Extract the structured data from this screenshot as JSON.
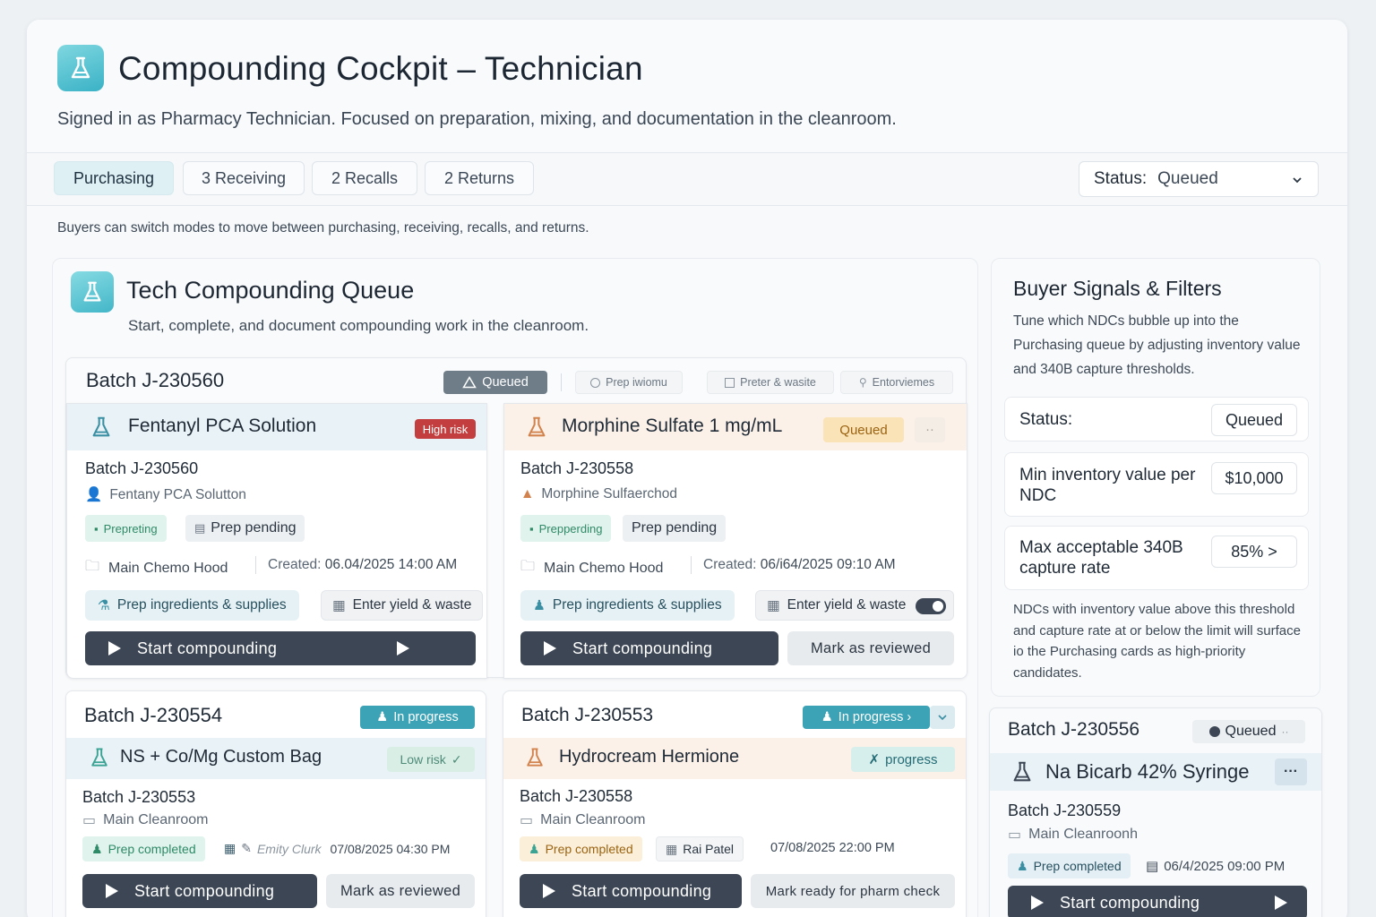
{
  "header": {
    "title": "Compounding Cockpit – Technician",
    "subtitle": "Signed in as Pharmacy Technician. Focused on preparation, mixing, and documentation in the cleanroom."
  },
  "tabs": [
    {
      "label": "Purchasing",
      "active": true
    },
    {
      "label": "3  Receiving",
      "active": false
    },
    {
      "label": "2  Recalls",
      "active": false
    },
    {
      "label": "2  Returns",
      "active": false
    }
  ],
  "status_filter": {
    "label": "Status:",
    "value": "Queued"
  },
  "helper_text": "Buyers can switch modes to move between purchasing, receiving, recalls, and returns.",
  "queue": {
    "title": "Tech Compounding Queue",
    "subtitle": "Start, complete, and document compounding work in the cleanroom.",
    "group": {
      "batch": "Batch J-230560",
      "status": "Queued",
      "chips": [
        "Prep iwiomu",
        "Preter & wasite",
        "Entorviemes"
      ],
      "cards": [
        {
          "product": "Fentanyl PCA Solution",
          "risk": "High risk",
          "batch": "Batch J-230560",
          "drug": "Fentany PCA Solutton",
          "stage_tag": "Prepreting",
          "prep_tag": "Prep pending",
          "location": "Main Chemo Hood",
          "created_label": "Created:",
          "created": "06.04/2025 14:00 AM",
          "action1": "Prep ingredients & supplies",
          "action2": "Enter yield & waste",
          "primary": "Start compounding"
        },
        {
          "product": "Morphine Sulfate 1 mg/mL",
          "status": "Queued",
          "more": "··",
          "batch": "Batch J-230558",
          "drug": "Morphine Sulfaerchod",
          "stage_tag": "Prepperding",
          "prep_tag": "Prep pending",
          "location": "Main Chemo Hood",
          "created_label": "Created:",
          "created": "06/i64/2025 09:10 AM",
          "action1": "Prep ingredients & supplies",
          "action2": "Enter yield & waste",
          "primary": "Start compounding",
          "secondary": "Mark as reviewed"
        }
      ]
    },
    "cards_bottom": [
      {
        "batch": "Batch J-230554",
        "status": "In progress",
        "product": "NS + Co/Mg Custom Bag",
        "risk": "Low risk",
        "sub_batch": "Batch J-230553",
        "location": "Main Cleanroom",
        "stage_tag": "Prep completed",
        "user": "Emity Clurk",
        "datetime": "07/08/2025  04:30 PM",
        "primary": "Start compounding",
        "secondary": "Mark as reviewed"
      },
      {
        "batch": "Batch J-230553",
        "status": "In progress ›",
        "product": "Hydrocream Hermione",
        "progress": "progress",
        "sub_batch": "Batch J-230558",
        "location": "Main Cleanroom",
        "stage_tag": "Prep completed",
        "user": "Rai Patel",
        "datetime": "07/08/2025 22:00 PM",
        "primary": "Start compounding",
        "secondary": "Mark ready for pharm check"
      }
    ]
  },
  "signals": {
    "title": "Buyer Signals & Filters",
    "description": "Tune which NDCs bubble up into  the Purchasing queue by adjusting inventory value and 340B capture thresholds.",
    "rows": [
      {
        "label": "Status:",
        "value": "Queued"
      },
      {
        "label": "Min inventory value per NDC",
        "value": "$10,000"
      },
      {
        "label": "Max acceptable 340B capture rate",
        "value": "85%   >"
      }
    ],
    "footnote": "NDCs with inventory value above this threshold and capture rate at or below the limit will surface io the Purchasing cards as high-priority candidates."
  },
  "side_card": {
    "batch": "Batch J-230556",
    "status": "Queued",
    "more": "··",
    "product": "Na Bicarb 42% Syringe",
    "menu": "···",
    "sub_batch": "Batch J-230559",
    "location": "Main Cleanroonh",
    "stage_tag": "Prep completed",
    "datetime": "06/4/2025 09:00 PM",
    "primary": "Start compounding"
  },
  "colors": {
    "accent": "#3ab2c6",
    "dark_button": "#3c4654",
    "high_risk": "#c33f3f",
    "queued_orange": "#fbe3b8"
  }
}
